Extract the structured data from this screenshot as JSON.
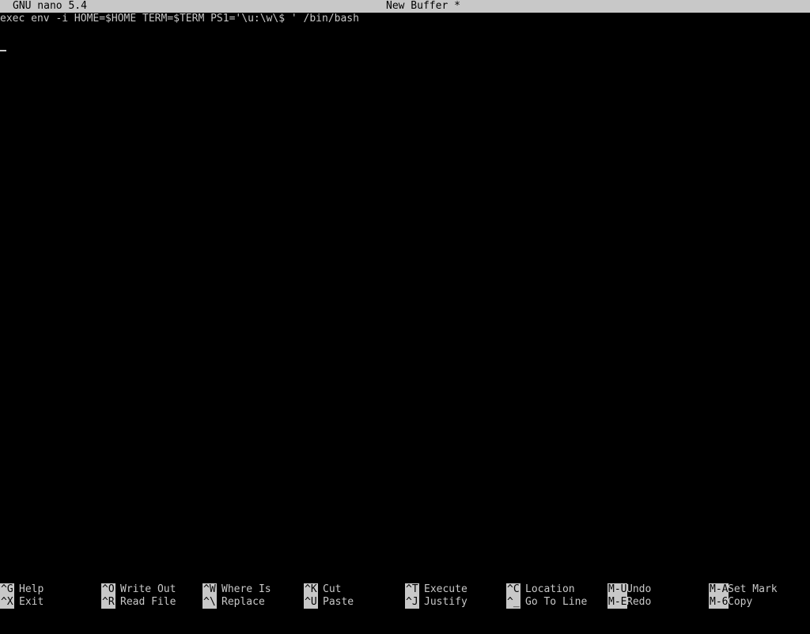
{
  "titlebar": {
    "app_version": "GNU nano 5.4",
    "buffer_name": "New Buffer *"
  },
  "editor": {
    "lines": [
      "exec env -i HOME=$HOME TERM=$TERM PS1='\\u:\\w\\$ ' /bin/bash"
    ]
  },
  "shortcuts": {
    "row1": [
      {
        "key": "^G",
        "label": "Help"
      },
      {
        "key": "^O",
        "label": "Write Out"
      },
      {
        "key": "^W",
        "label": "Where Is"
      },
      {
        "key": "^K",
        "label": "Cut"
      },
      {
        "key": "^T",
        "label": "Execute"
      },
      {
        "key": "^C",
        "label": "Location"
      },
      {
        "key": "M-U",
        "label": "Undo"
      },
      {
        "key": "M-A",
        "label": "Set Mark"
      }
    ],
    "row2": [
      {
        "key": "^X",
        "label": "Exit"
      },
      {
        "key": "^R",
        "label": "Read File"
      },
      {
        "key": "^\\",
        "label": "Replace"
      },
      {
        "key": "^U",
        "label": "Paste"
      },
      {
        "key": "^J",
        "label": "Justify"
      },
      {
        "key": "^_",
        "label": "Go To Line"
      },
      {
        "key": "M-E",
        "label": "Redo"
      },
      {
        "key": "M-6",
        "label": "Copy"
      }
    ]
  },
  "colors": {
    "background": "#000000",
    "foreground": "#c8c8c8",
    "inverse_background": "#c8c8c8",
    "inverse_foreground": "#000000"
  }
}
